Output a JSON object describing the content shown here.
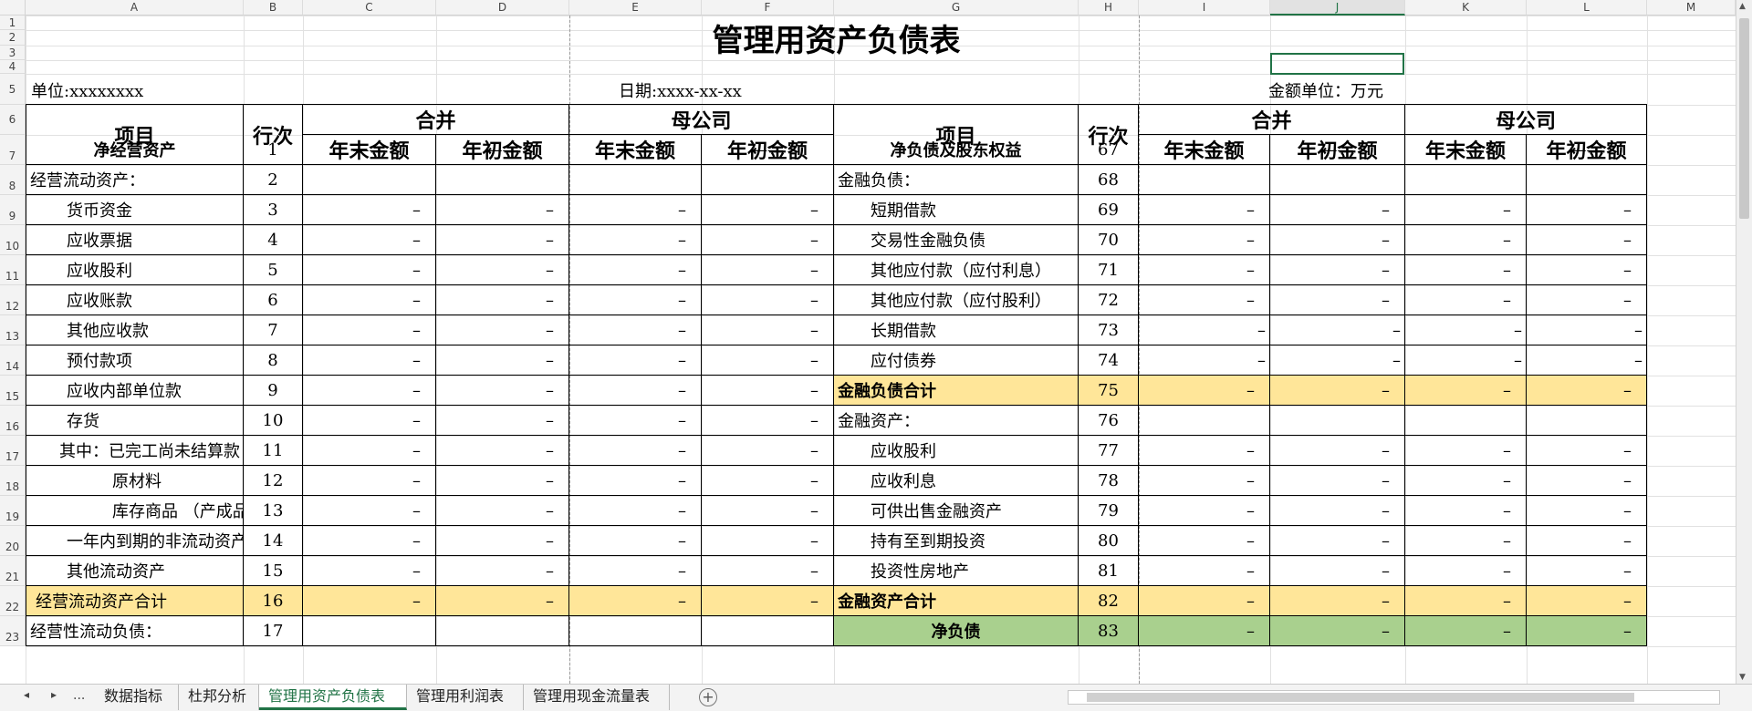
{
  "columns": [
    "A",
    "B",
    "C",
    "D",
    "E",
    "F",
    "G",
    "H",
    "I",
    "J",
    "K",
    "L",
    "M"
  ],
  "active_column": "J",
  "rows": [
    "1",
    "2",
    "3",
    "4",
    "5",
    "6",
    "7",
    "8",
    "9",
    "10",
    "11",
    "12",
    "13",
    "14",
    "15",
    "16",
    "17",
    "18",
    "19",
    "20",
    "21",
    "22",
    "23"
  ],
  "title": "管理用资产负债表",
  "unit_label": "单位:xxxxxxxx",
  "date_label": "日期:xxxx-xx-xx",
  "amount_unit": "金额单位：万元",
  "headers": {
    "item": "项目",
    "line_no": "行次",
    "consolidated": "合并",
    "parent": "母公司",
    "end_amount": "年末金额",
    "begin_amount": "年初金额"
  },
  "dash_long": "——",
  "dash": "–",
  "left_rows": [
    {
      "item": "净经营资产",
      "no": "1"
    },
    {
      "item": "经营流动资产：",
      "no": "2"
    },
    {
      "item": "货币资金",
      "no": "3"
    },
    {
      "item": "应收票据",
      "no": "4"
    },
    {
      "item": "应收股利",
      "no": "5"
    },
    {
      "item": "应收账款",
      "no": "6"
    },
    {
      "item": "其他应收款",
      "no": "7"
    },
    {
      "item": "预付款项",
      "no": "8"
    },
    {
      "item": "应收内部单位款",
      "no": "9"
    },
    {
      "item": "存货",
      "no": "10"
    },
    {
      "item": "其中：已完工尚未结算款",
      "no": "11"
    },
    {
      "item": "原材料",
      "no": "12"
    },
    {
      "item": "库存商品 （产成品）",
      "no": "13"
    },
    {
      "item": "一年内到期的非流动资产",
      "no": "14"
    },
    {
      "item": "其他流动资产",
      "no": "15"
    },
    {
      "item": "经营流动资产合计",
      "no": "16"
    },
    {
      "item": "经营性流动负债：",
      "no": "17"
    }
  ],
  "right_rows": [
    {
      "item": "净负债及股东权益",
      "no": "67"
    },
    {
      "item": "金融负债：",
      "no": "68"
    },
    {
      "item": "短期借款",
      "no": "69"
    },
    {
      "item": "交易性金融负债",
      "no": "70"
    },
    {
      "item": "其他应付款（应付利息）",
      "no": "71"
    },
    {
      "item": "其他应付款（应付股利）",
      "no": "72"
    },
    {
      "item": "长期借款",
      "no": "73"
    },
    {
      "item": "应付债券",
      "no": "74"
    },
    {
      "item": "金融负债合计",
      "no": "75"
    },
    {
      "item": "金融资产：",
      "no": "76"
    },
    {
      "item": "应收股利",
      "no": "77"
    },
    {
      "item": "应收利息",
      "no": "78"
    },
    {
      "item": "可供出售金融资产",
      "no": "79"
    },
    {
      "item": "持有至到期投资",
      "no": "80"
    },
    {
      "item": "投资性房地产",
      "no": "81"
    },
    {
      "item": "金融资产合计",
      "no": "82"
    },
    {
      "item": "净负债",
      "no": "83"
    }
  ],
  "sheet_tabs": [
    "数据指标",
    "杜邦分析",
    "管理用资产负债表",
    "管理用利润表",
    "管理用现金流量表"
  ],
  "active_tab": "管理用资产负债表",
  "tab_nav": {
    "first": "◂",
    "next": "▸",
    "more": "..."
  },
  "add_sheet": "+",
  "colors": {
    "accent": "#217346",
    "subtotal": "#ffe699",
    "net_debt": "#a9d08e"
  }
}
